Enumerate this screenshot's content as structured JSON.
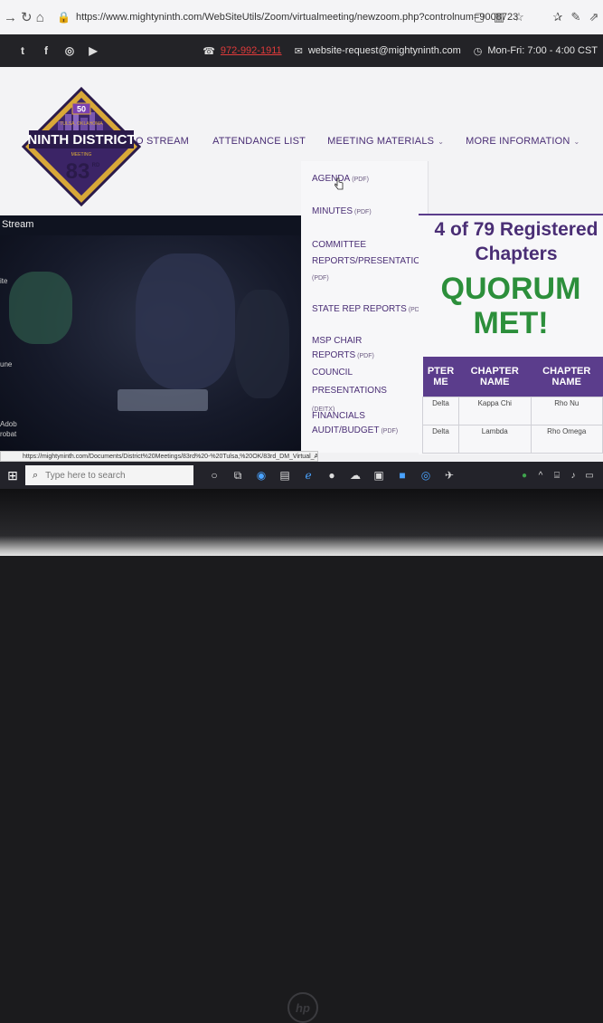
{
  "browser": {
    "url": "https://www.mightyninth.com/WebSiteUtils/Zoom/virtualmeeting/newzoom.php?controlnum=9008723"
  },
  "topbar": {
    "phone": "972-992-1911",
    "email": "website-request@mightyninth.com",
    "hours": "Mon-Fri: 7:00 - 4:00 CST"
  },
  "logo": {
    "badge": "50",
    "city": "TULSA, OKLAHOMA",
    "title": "NINTH DISTRICT",
    "meeting_word": "MEETING",
    "number": "83",
    "suffix": "RD"
  },
  "nav": {
    "stream": "O STREAM",
    "attendance": "ATTENDANCE LIST",
    "materials": "MEETING MATERIALS",
    "more": "MORE INFORMATION"
  },
  "dropdown": {
    "agenda": "AGENDA",
    "agenda_tag": "(PDF)",
    "minutes": "MINUTES",
    "minutes_tag": "(PDF)",
    "committee_1": "COMMITTEE",
    "committee_2": "REPORTS/PRESENTATIONS",
    "committee_tag": "(PDF)",
    "state_rep": "STATE REP REPORTS",
    "state_rep_tag": "(PDF)",
    "msp_chair": "MSP CHAIR REPORTS",
    "msp_chair_tag": "(PDF)",
    "council": "COUNCIL PRESENTATIONS",
    "council_tag": "(DEITX)",
    "financials_1": "FINANCIALS",
    "financials_2": "AUDIT/BUDGET",
    "financials_tag": "(PDF)"
  },
  "stream": {
    "label": "Stream"
  },
  "quorum_panel": {
    "registered_line1": "4 of 79 Registered",
    "registered_line2": "Chapters",
    "quorum_line1": "QUORUM",
    "quorum_line2": "MET!",
    "table": {
      "headers": [
        [
          "PTER",
          "ME"
        ],
        [
          "CHAPTER",
          "NAME"
        ],
        [
          "CHAPTER",
          "NAME"
        ]
      ],
      "rows": [
        [
          "Delta",
          "Kappa Chi",
          "Rho Nu"
        ],
        [
          "Delta",
          "Lambda",
          "Rho Omega"
        ]
      ]
    }
  },
  "left_edge": {
    "frag1": "ite",
    "frag2": "une",
    "frag3": "Adob",
    "frag4": "robat"
  },
  "statusbar": {
    "text": "https://mightyninth.com/Documents/District%20Meetings/83rd%20-%20Tulsa,%20OK/83rd_DM_Virtual_A"
  },
  "taskbar": {
    "search_placeholder": "Type here to search"
  },
  "colors": {
    "brand_purple": "#4a2e75",
    "quorum_green": "#2c8f3b",
    "table_header": "#5b3d8c",
    "phone_red": "#e03a3a"
  }
}
